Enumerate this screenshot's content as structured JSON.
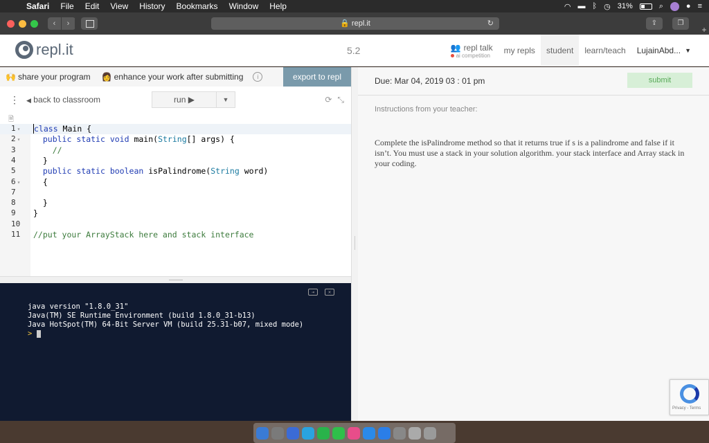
{
  "menubar": {
    "app": "Safari",
    "items": [
      "File",
      "Edit",
      "View",
      "History",
      "Bookmarks",
      "Window",
      "Help"
    ],
    "battery": "31%"
  },
  "browser": {
    "url": "repl.it"
  },
  "header": {
    "logo": "repl.it",
    "version": "5.2",
    "talk_label": "repl talk",
    "talk_sub": "ai competition",
    "nav": [
      "my repls",
      "student",
      "learn/teach"
    ],
    "user": "LujainAbd..."
  },
  "leftpane": {
    "share_label": "share your program",
    "enhance_label": "enhance your work after submitting",
    "info": "i",
    "export_label": "export to repl",
    "back_label": "back to classroom",
    "run_label": "run ▶"
  },
  "editor": {
    "lines": [
      {
        "num": "1",
        "fold": true
      },
      {
        "num": "2",
        "fold": true
      },
      {
        "num": "3",
        "fold": false
      },
      {
        "num": "4",
        "fold": false
      },
      {
        "num": "5",
        "fold": false
      },
      {
        "num": "6",
        "fold": true
      },
      {
        "num": "7",
        "fold": false
      },
      {
        "num": "8",
        "fold": false
      },
      {
        "num": "9",
        "fold": false
      },
      {
        "num": "10",
        "fold": false
      },
      {
        "num": "11",
        "fold": false
      }
    ],
    "code": {
      "l1a": "class",
      "l1b": " Main {",
      "l2_pub": "public",
      "l2_static": "static",
      "l2_void": "void",
      "l2_main": " main(",
      "l2_string": "String",
      "l2_rest": "[] args) {",
      "l3": "//",
      "l4": "}",
      "l5_pub": "public",
      "l5_static": "static",
      "l5_bool": "boolean",
      "l5_name": " isPalindrome(",
      "l5_string": "String",
      "l5_rest": " word)",
      "l6": "{",
      "l8": "}",
      "l9": "}",
      "l11": "//put your ArrayStack here and stack interface"
    }
  },
  "console": {
    "lines": [
      "java version \"1.8.0_31\"",
      "Java(TM) SE Runtime Environment (build 1.8.0_31-b13)",
      "Java HotSpot(TM) 64-Bit Server VM (build 25.31-b07, mixed mode)"
    ],
    "prompt": ">"
  },
  "rightpane": {
    "due": "Due: Mar 04, 2019 03 : 01 pm",
    "submit_label": "submit",
    "instructions_title": "Instructions from your teacher:",
    "instructions": "Complete the isPalindrome method so that it returns true if s is a palindrome and false if it isn’t. You must use a stack in your solution algorithm. your stack interface and Array stack in your coding."
  },
  "recaptcha": {
    "text": "Privacy - Terms"
  },
  "dock": {
    "apps": [
      {
        "icon": "finder-icon",
        "color": "#3a7bd5"
      },
      {
        "icon": "launchpad-icon",
        "color": "#7a7a7a"
      },
      {
        "icon": "messages-icon",
        "color": "#3b6bd6"
      },
      {
        "icon": "telegram-icon",
        "color": "#2aa3e0"
      },
      {
        "icon": "whatsapp-icon",
        "color": "#29b34a"
      },
      {
        "icon": "facetime-icon",
        "color": "#2fbf4a"
      },
      {
        "icon": "itunes-icon",
        "color": "#e84d8a"
      },
      {
        "icon": "safari-icon",
        "color": "#2a8ae8"
      },
      {
        "icon": "appstore-icon",
        "color": "#2b7ee8"
      },
      {
        "icon": "system-prefs-icon",
        "color": "#888888"
      },
      {
        "icon": "preview-icon",
        "color": "#aaaaaa"
      },
      {
        "icon": "trash-icon",
        "color": "#9a9a9a"
      }
    ]
  },
  "colors": {
    "export_bg": "#7a9aab",
    "console_bg": "#101a30",
    "submit_bg": "#d7efd7",
    "keyword": "#1f3bb3",
    "comment": "#3b7a3b"
  }
}
